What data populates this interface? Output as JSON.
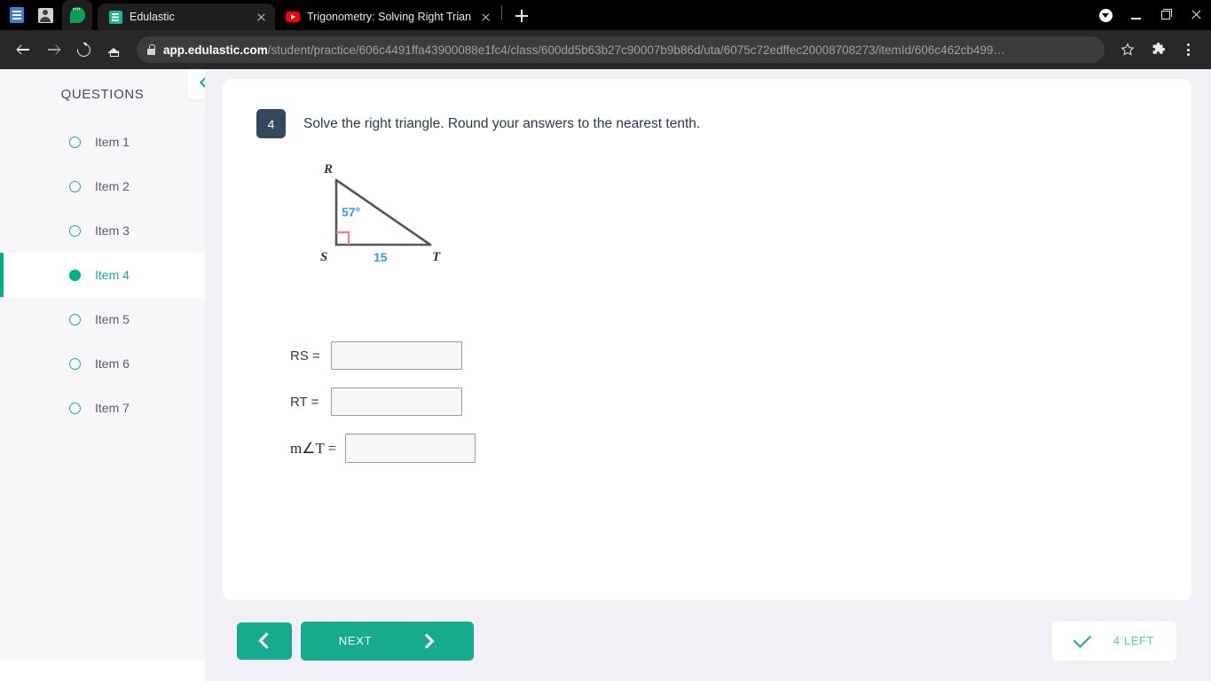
{
  "browser": {
    "shortcuts": [
      {
        "name": "docs-shortcut-icon",
        "icon": "document-icon"
      },
      {
        "name": "contacts-shortcut-icon",
        "icon": "person-icon"
      },
      {
        "name": "hangouts-shortcut-icon",
        "icon": "chat-bubble-icon"
      }
    ],
    "tabs": [
      {
        "title": "Edulastic",
        "favicon": "edulastic-icon",
        "active": true
      },
      {
        "title": "Trigonometry: Solving Right Trian",
        "favicon": "youtube-icon",
        "active": false
      }
    ],
    "new_tab_label": "+",
    "url": {
      "host": "app.edulastic.com",
      "path": "/student/practice/606c4491ffa43900088e1fc4/class/600dd5b63b27c90007b9b86d/uta/6075c72edffec20008708273/itemId/606c462cb499…",
      "secure_icon": "lock-icon"
    },
    "toolbar_icons": {
      "back": "back-arrow-icon",
      "forward": "forward-arrow-icon",
      "reload": "reload-icon",
      "home": "home-icon",
      "bookmark": "star-icon",
      "extensions": "puzzle-piece-icon",
      "menu": "three-dot-menu-icon"
    },
    "window_controls": {
      "downloads": "download-circle-icon",
      "minimize": "minimize-icon",
      "restore": "restore-icon",
      "close": "close-icon"
    }
  },
  "sidebar": {
    "title": "QUESTIONS",
    "collapse_icon": "chevron-left-icon",
    "items": [
      {
        "label": "Item 1",
        "active": false
      },
      {
        "label": "Item 2",
        "active": false
      },
      {
        "label": "Item 3",
        "active": false
      },
      {
        "label": "Item 4",
        "active": true
      },
      {
        "label": "Item 5",
        "active": false
      },
      {
        "label": "Item 6",
        "active": false
      },
      {
        "label": "Item 7",
        "active": false
      }
    ]
  },
  "question": {
    "number": "4",
    "prompt": "Solve the right triangle. Round your answers to the nearest tenth.",
    "figure": {
      "type": "right-triangle",
      "vertices": [
        "R",
        "S",
        "T"
      ],
      "right_angle_at": "S",
      "angle_label": "57°",
      "side_label": "15",
      "side_labeled": "ST",
      "label_color": "#2f9fe0",
      "line_color": "#575757",
      "right_angle_color": "#f07f82"
    },
    "answers": [
      {
        "label": "RS =",
        "value": "",
        "placeholder": "",
        "math": false
      },
      {
        "label": "RT =",
        "value": "",
        "placeholder": "",
        "math": false
      },
      {
        "label": "m∠T =",
        "value": "",
        "placeholder": "",
        "math": true
      }
    ]
  },
  "footer": {
    "prev_label": "",
    "prev_icon": "chevron-left-icon",
    "next_label": "NEXT",
    "next_icon": "chevron-right-icon",
    "remaining_label": "4 LEFT",
    "remaining_icon": "check-icon"
  },
  "colors": {
    "accent_teal": "#16ab8e",
    "badge_navy": "#34495f",
    "page_bg": "#f1f1f5",
    "sidebar_bg": "#f7f7f9",
    "left_text": "#4dd0b4"
  }
}
